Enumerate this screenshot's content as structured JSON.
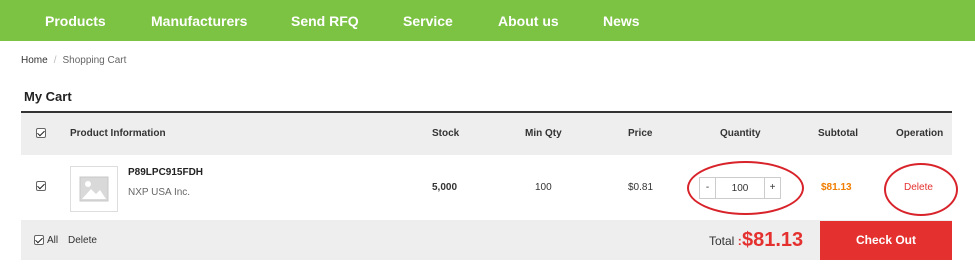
{
  "nav": {
    "items": [
      "Products",
      "Manufacturers",
      "Send RFQ",
      "Service",
      "About us",
      "News"
    ]
  },
  "breadcrumb": {
    "home": "Home",
    "separator": "/",
    "current": "Shopping Cart"
  },
  "cart": {
    "title": "My Cart",
    "headers": {
      "product": "Product Information",
      "stock": "Stock",
      "min_qty": "Min Qty",
      "price": "Price",
      "quantity": "Quantity",
      "subtotal": "Subtotal",
      "operation": "Operation"
    },
    "items": [
      {
        "checked": true,
        "part_number": "P89LPC915FDH",
        "manufacturer": "NXP USA Inc.",
        "stock": "5,000",
        "min_qty": "100",
        "price": "$0.81",
        "quantity": "100",
        "qty_minus": "-",
        "qty_plus": "+",
        "subtotal": "$81.13",
        "operation": "Delete"
      }
    ],
    "footer": {
      "select_all_label": "All",
      "delete_label": "Delete",
      "total_label": "Total",
      "total_separator": ":",
      "total_value": "$81.13",
      "checkout_label": "Check Out"
    }
  },
  "colors": {
    "nav_bg": "#7cc243",
    "accent_red": "#e4312f",
    "subtotal_orange": "#f07c00",
    "annotation_red": "#d8232a"
  },
  "icons": [
    "image-placeholder-icon",
    "checkbox-checked-icon"
  ]
}
